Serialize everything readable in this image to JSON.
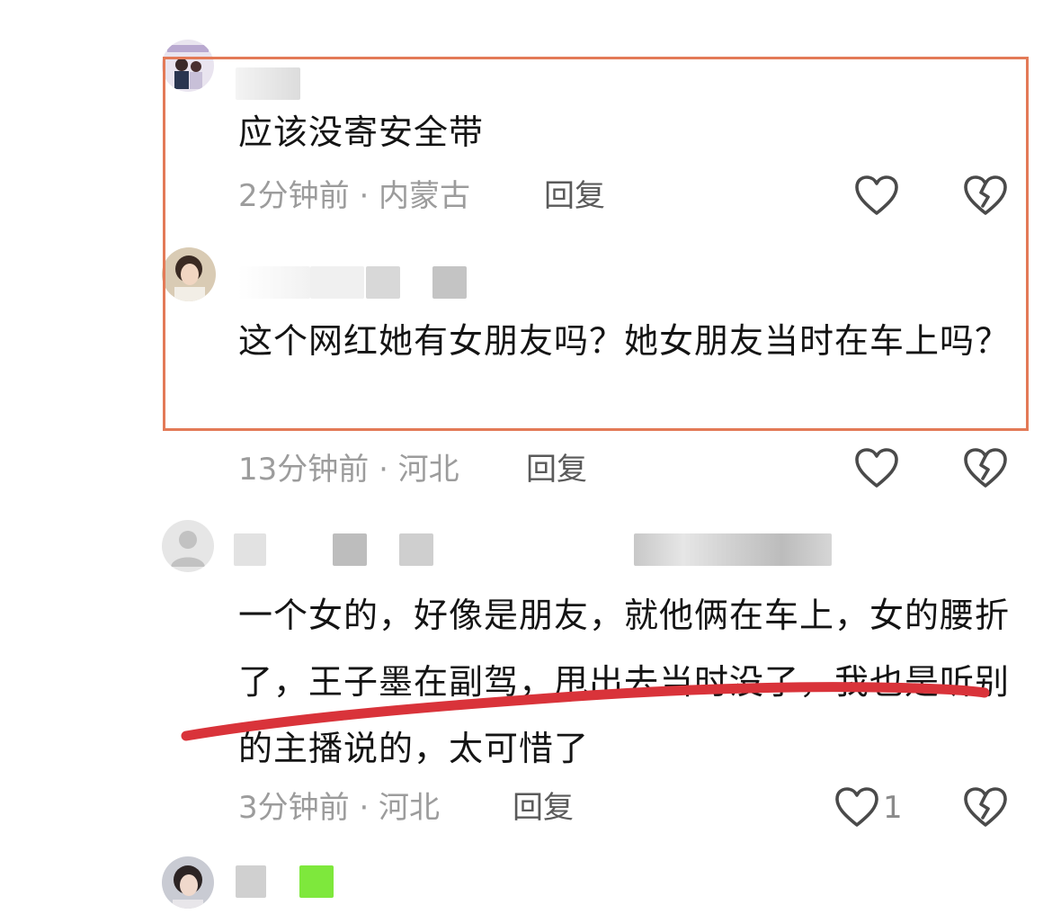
{
  "comments": [
    {
      "text": "应该没寄安全带",
      "time_location": "2分钟前 · 内蒙古",
      "reply_label": "回复"
    },
    {
      "text": "这个网红她有女朋友吗？她女朋友当时在车上吗？",
      "time_location": "13分钟前 · 河北",
      "reply_label": "回复"
    },
    {
      "text": "一个女的，好像是朋友，就他俩在车上，女的腰折了，王子墨在副驾，甩出去当时没了，我也是听别的主播说的，太可惜了",
      "time_location": "3分钟前 · 河北",
      "reply_label": "回复",
      "like_count": "1"
    }
  ],
  "icons": {
    "like": "heart-outline-icon",
    "dislike": "broken-heart-icon"
  },
  "colors": {
    "highlight_box": "#e37a57",
    "underline_stroke": "#d9333a",
    "meta_text": "#9c9c9c",
    "icon": "#4a4a4a"
  }
}
